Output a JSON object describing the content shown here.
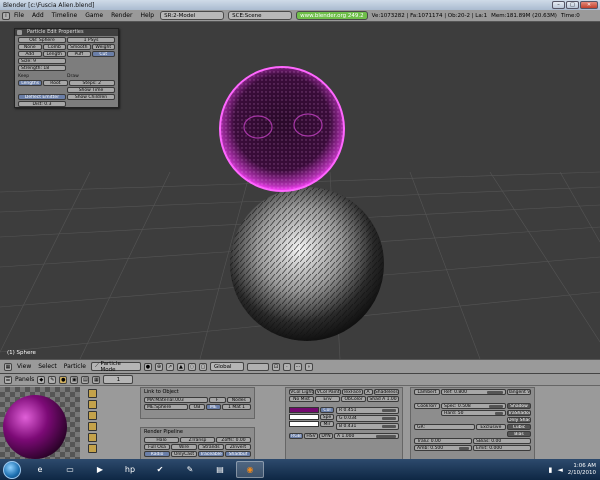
{
  "window": {
    "title": "Blender [c:\\Fuscia Alien.blend]",
    "controls": {
      "minimize": "–",
      "maximize": "□",
      "close": "✕"
    }
  },
  "menubar": {
    "items": [
      "File",
      "Add",
      "Timeline",
      "Game",
      "Render",
      "Help"
    ],
    "screen": "SR:2-Model",
    "scene": "SCE:Scene",
    "website": "www.blender.org 249.2",
    "stats": "Ve:1073282 | Fa:1071174 | Ob:20-2 | La:1",
    "memory": "Mem:181.89M (20.63M)",
    "time": "Time:0"
  },
  "particle_panel": {
    "title": "Particle Edit Properties",
    "object": "OB: Sphere",
    "psys": "1 PSys",
    "brush_row1": [
      "None",
      "Comb",
      "Smooth",
      "Weight"
    ],
    "brush_row2": [
      "Add",
      "Length",
      "Puff",
      "Cut"
    ],
    "size": "Size: 9",
    "strength": "Strength: 18",
    "keep_label": "Keep",
    "draw_label": "Draw",
    "keep_row": [
      "Lengths",
      "Root"
    ],
    "steps": "Steps: 2",
    "show_time": "Show Time",
    "deflect": "Deflect Emitter",
    "show_children": "Show Children",
    "dist": "Dist: 0.3"
  },
  "viewport": {
    "label": "(1) Sphere"
  },
  "viewport_header": {
    "view": "View",
    "select": "Select",
    "particle": "Particle",
    "mode": "Particle Mode",
    "pivot": "Global",
    "layer": "1"
  },
  "buttons_window": {
    "panels_label": "Panels",
    "frame": "1",
    "link_to_object": "Link to Object",
    "material": "MA:Material.003",
    "mesh": "ME:Sphere",
    "ob_label": "OB",
    "me_label": "ME",
    "mat_count": "1 Mat 1",
    "f_label": "F",
    "nodes_label": "Nodes",
    "render_pipeline": "Render Pipeline",
    "pipeline_row1": [
      "Halo",
      "ZTransp",
      "Zoffs: 0.00"
    ],
    "pipeline_row2": [
      "Full Osa",
      "Wire",
      "Strands",
      "ZInvert"
    ],
    "pipeline_row3": [
      "Radio",
      "OnlyCast",
      "Traceable",
      "Shadbuf"
    ],
    "vcol_row": [
      "VCol Light",
      "VCol Paint",
      "TexFace",
      "A",
      "Shadeless"
    ],
    "nomist_row": [
      "No Mist",
      "Env",
      "ObColor",
      "Shad A 1.00"
    ],
    "color_labels": [
      "Col",
      "Spe",
      "Mir"
    ],
    "rgb": [
      "R 0.451",
      "G 0.034",
      "B 0.431"
    ],
    "color_modes": [
      "RGB",
      "HSV",
      "DYN"
    ],
    "alpha": "A 1.000",
    "diffuse": "Lambert",
    "ref": "Ref: 0.800",
    "specular": "CookTorr",
    "spec": "Spec: 0.508",
    "hard": "Hard: 50",
    "tangent": "Tangent V",
    "side_buttons": [
      "Shadow",
      "TraShadow",
      "Only Shad",
      "Cubic",
      "Bias"
    ],
    "gr_label": "GR:",
    "exclusive": "Exclusive",
    "tralu": "Tralu: 0.00",
    "sbias": "SBias: 0.00",
    "amb": "Amb: 0.500",
    "emit": "Emit: 0.000",
    "material_color": "#73086e"
  },
  "taskbar": {
    "time": "1:06 AM",
    "date": "2/10/2010"
  }
}
